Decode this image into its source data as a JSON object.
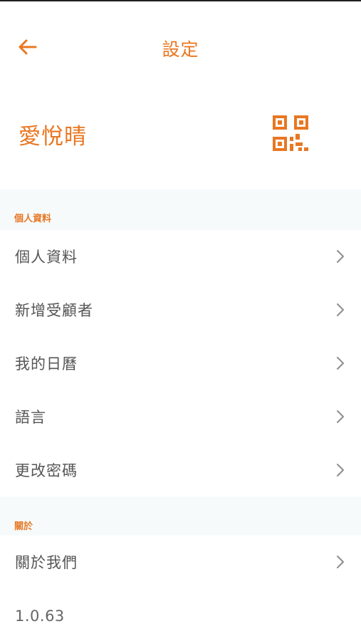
{
  "header": {
    "title": "設定",
    "back_icon": "arrow-left-icon"
  },
  "profile": {
    "name": "愛悅晴",
    "qr_icon": "qr-code-icon"
  },
  "sections": {
    "personal": {
      "header": "個人資料",
      "items": [
        {
          "label": "個人資料"
        },
        {
          "label": "新增受顧者"
        },
        {
          "label": "我的日曆"
        },
        {
          "label": "語言"
        },
        {
          "label": "更改密碼"
        }
      ]
    },
    "about": {
      "header": "關於",
      "items": [
        {
          "label": "關於我們"
        }
      ],
      "version": "1.0.63"
    }
  },
  "colors": {
    "accent": "#e87722",
    "section_bg": "#f6fafb",
    "text": "#555555",
    "chevron": "#8e8e8e"
  }
}
